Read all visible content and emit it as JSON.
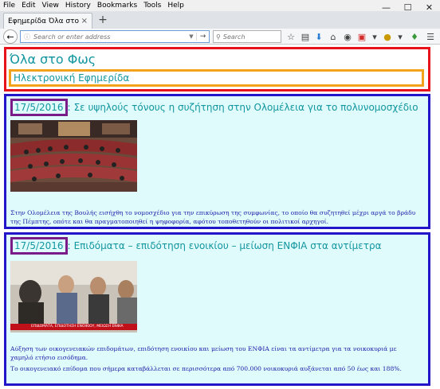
{
  "menu": {
    "items": [
      "File",
      "Edit",
      "View",
      "History",
      "Bookmarks",
      "Tools",
      "Help"
    ]
  },
  "window_controls": {
    "minimize": "—",
    "maximize": "☐",
    "close": "✕"
  },
  "tab": {
    "title": "Εφημερίδα Όλα στο Φως",
    "close": "×"
  },
  "new_tab": "+",
  "nav": {
    "url_placeholder": "Search or enter address",
    "search_placeholder": "Search"
  },
  "page": {
    "site_title": "Όλα στο Φως",
    "subtitle": "Ηλεκτρονική Εφημερίδα",
    "articles": [
      {
        "date": "17/5/2016",
        "headline": "Σε υψηλούς τόνους η συζήτηση στην Ολομέλεια για το πολυνομοσχέδιο",
        "paragraphs": [
          "Στην Ολομέλεια της Βουλής εισήχθη το νομοσχέδιο για την επικύρωση της συμφωνίας, το οποίο θα συζητηθεί μέχρι αργά το βράδυ της Πέμπτης, οπότε και θα πραγματοποιηθεί η ψηφοφορία, αφότου τοποθετηθούν οι πολιτικοί αρχηγοί."
        ]
      },
      {
        "date": "17/5/2016",
        "headline": "Επιδόματα – επιδότηση ενοικίου – μείωση ΕΝΦΙΑ στα αντίμετρα",
        "photo_caption": "ΕΠΙΔΟΜΑΤΑ, ΕΠΙΔΟΤΗΣΗ ΕΝΟΙΚΙΟΥ, ΜΕΙΩΣΗ ΕΝΦΙΑ",
        "paragraphs": [
          "Αύξηση των οικογενειακών επιδομάτων, επιδότηση ενοικίου και μείωση του ΕΝΦΙΑ είναι τα αντίμετρα για τα νοικοκυριά με χαμηλό ετήσιο εισόδημα.",
          "Το οικογενειακό επίδομα που σήμερα καταβάλλεται σε περισσότερα από 700.000 νοικοκυριά αυξάνεται από 50 έως και 188%."
        ]
      }
    ]
  },
  "colors": {
    "header_border": "#e8131a",
    "subtitle_border": "#f3a31b",
    "article_border": "#2216c8",
    "date_border": "#7a1b8a",
    "heading_text": "#1296a0",
    "body_text": "#1a1aa8",
    "article_bg": "#e0fbfb"
  }
}
